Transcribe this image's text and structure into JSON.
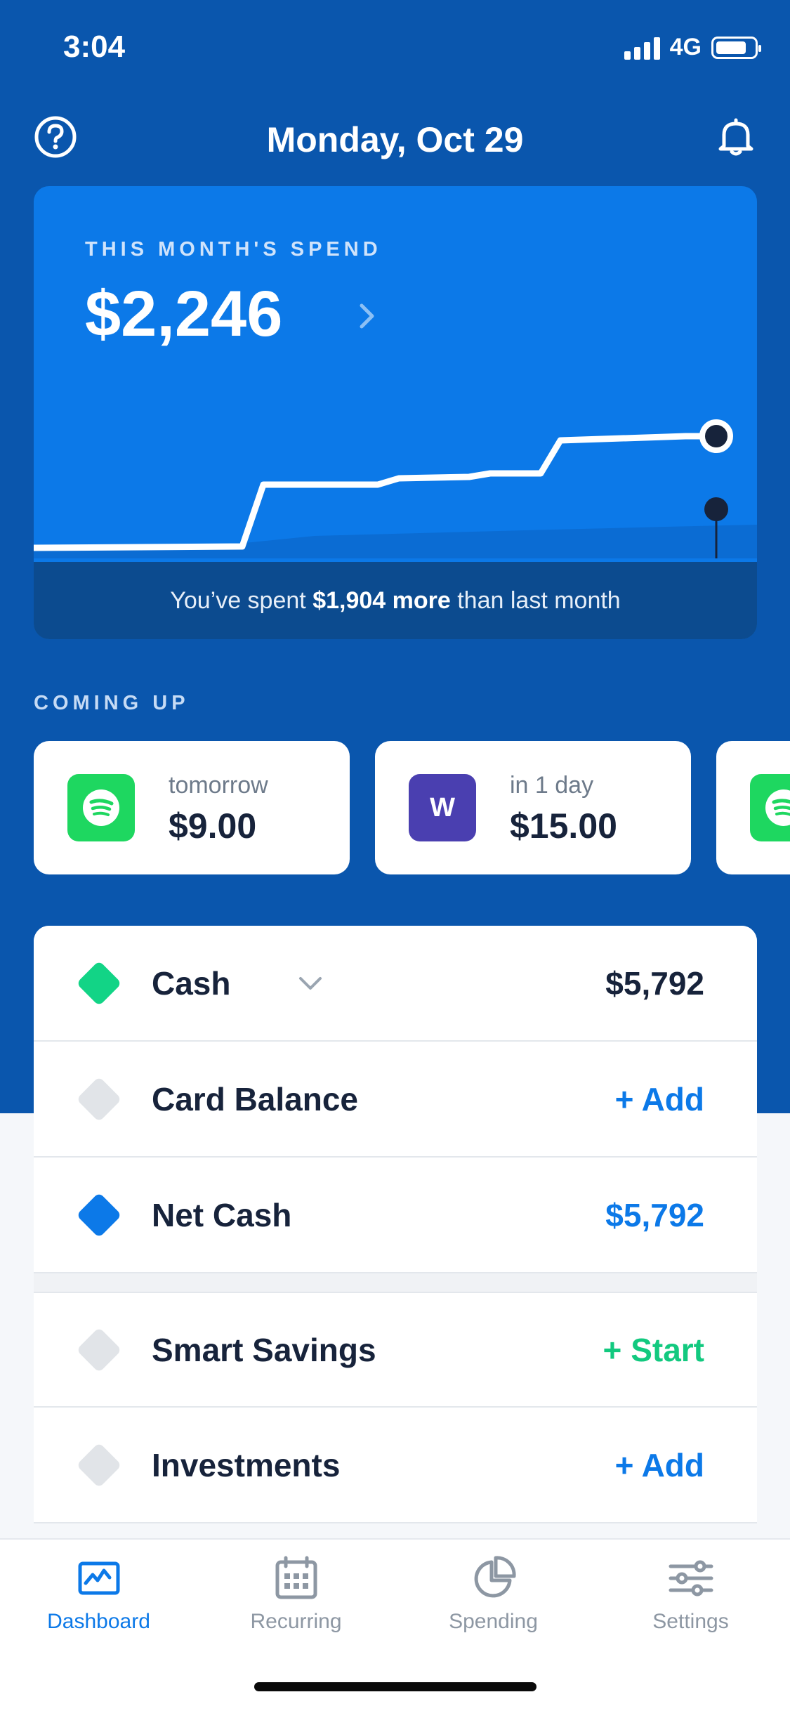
{
  "status": {
    "time": "3:04",
    "network": "4G"
  },
  "header": {
    "title": "Monday, Oct 29"
  },
  "spend": {
    "label": "THIS MONTH'S SPEND",
    "amount": "$2,246",
    "footer_prefix": "You’ve spent",
    "footer_bold": "$1,904 more",
    "footer_suffix": "than last month"
  },
  "coming_up": {
    "label": "COMING UP",
    "items": [
      {
        "when": "tomorrow",
        "amount": "$9.00",
        "logo": "spotify-icon",
        "color": "#1ed760"
      },
      {
        "when": "in 1 day",
        "amount": "$15.00",
        "logo": "W",
        "color": "#4a3fb0"
      },
      {
        "when": "",
        "amount": "",
        "logo": "spotify-icon",
        "color": "#1ed760"
      }
    ]
  },
  "accounts": [
    {
      "label": "Cash",
      "value": "$5,792",
      "diamond_color": "#12d486",
      "value_color": "#17233b",
      "has_chevron": true
    },
    {
      "label": "Card Balance",
      "value": "+ Add",
      "diamond_color": "#e1e4e8",
      "value_color": "#0c79e8"
    },
    {
      "label": "Net Cash",
      "value": "$5,792",
      "diamond_color": "#0c79e8",
      "value_color": "#0c79e8"
    },
    {
      "label": "Smart Savings",
      "value": "+ Start",
      "diamond_color": "#e1e4e8",
      "value_color": "#12c97f"
    },
    {
      "label": "Investments",
      "value": "+ Add",
      "diamond_color": "#e1e4e8",
      "value_color": "#0c79e8"
    }
  ],
  "tabs": [
    {
      "label": "Dashboard",
      "icon": "dashboard-icon",
      "active": true
    },
    {
      "label": "Recurring",
      "icon": "calendar-icon",
      "active": false
    },
    {
      "label": "Spending",
      "icon": "pie-chart-icon",
      "active": false
    },
    {
      "label": "Settings",
      "icon": "sliders-icon",
      "active": false
    }
  ],
  "colors": {
    "brand_blue": "#0a56ad",
    "card_blue": "#0c79e8",
    "green": "#12d486"
  }
}
